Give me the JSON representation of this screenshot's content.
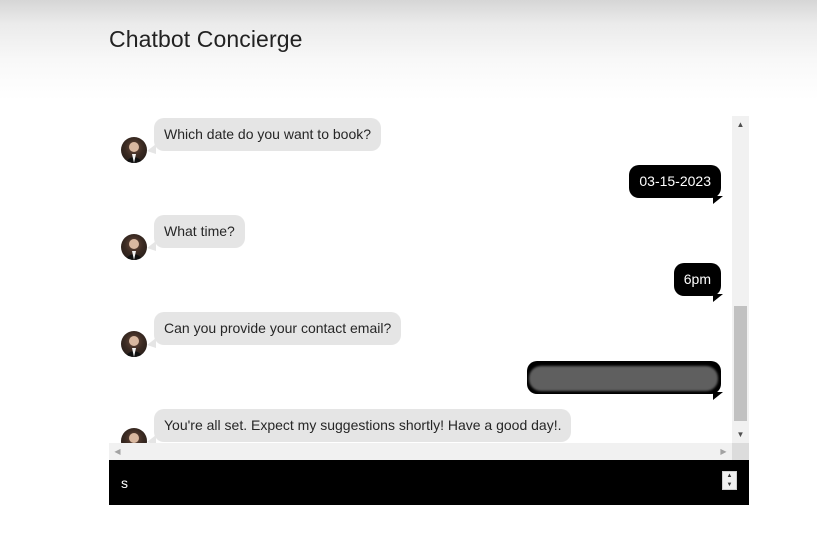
{
  "app": {
    "title": "Chatbot Concierge"
  },
  "chat": {
    "messages": [
      {
        "sender": "bot",
        "text": "Which date do you want to book?"
      },
      {
        "sender": "user",
        "text": "03-15-2023"
      },
      {
        "sender": "bot",
        "text": "What time?"
      },
      {
        "sender": "user",
        "text": "6pm"
      },
      {
        "sender": "bot",
        "text": "Can you provide your contact email?"
      },
      {
        "sender": "user",
        "text": "",
        "redacted": true
      },
      {
        "sender": "bot",
        "text": "You're all set. Expect my suggestions shortly! Have a good day!."
      }
    ]
  },
  "scrollbars": {
    "up_icon": "▲",
    "down_icon": "▼",
    "left_icon": "◀",
    "right_icon": "▶"
  },
  "input": {
    "value": "s",
    "placeholder": ""
  },
  "colors": {
    "bot_bubble": "#e5e5e5",
    "user_bubble": "#000000",
    "input_bar": "#000000"
  }
}
